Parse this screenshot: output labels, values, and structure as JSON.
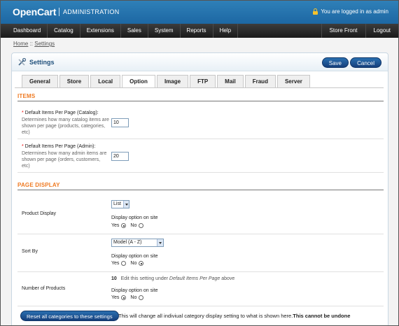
{
  "header": {
    "logo": "OpenCart",
    "subtitle": "ADMINISTRATION",
    "login_status": "You are logged in as admin"
  },
  "menu": {
    "left": [
      "Dashboard",
      "Catalog",
      "Extensions",
      "Sales",
      "System",
      "Reports",
      "Help"
    ],
    "right": [
      "Store Front",
      "Logout"
    ]
  },
  "breadcrumb": {
    "home": "Home",
    "separator": " :: ",
    "current": "Settings"
  },
  "page": {
    "title": "Settings",
    "save_label": "Save",
    "cancel_label": "Cancel",
    "tabs": [
      "General",
      "Store",
      "Local",
      "Option",
      "Image",
      "FTP",
      "Mail",
      "Fraud",
      "Server"
    ],
    "active_tab": "Option"
  },
  "items_section": {
    "title": "ITEMS",
    "catalog": {
      "label": "Default Items Per Page (Catalog):",
      "help": "Determines how many catalog items are shown per page (products, categories, etc)",
      "value": "10"
    },
    "admin": {
      "label": "Default Items Per Page (Admin):",
      "help": "Determines how many admin items are shown per page (orders, customers, etc)",
      "value": "20"
    }
  },
  "page_display": {
    "title": "PAGE DISPLAY",
    "product_display": {
      "label": "Product Display",
      "selected": "List",
      "option_label": "Display option on site",
      "yes": "Yes",
      "no": "No",
      "yes_checked": true
    },
    "sort_by": {
      "label": "Sort By",
      "selected": "Model (A - Z)",
      "option_label": "Display option on site",
      "yes": "Yes",
      "no": "No",
      "yes_checked": false
    },
    "number_of_products": {
      "label": "Number of Products",
      "value": "10",
      "note_prefix": "Edit this setting under ",
      "note_emphasis": "Default Items Per Page",
      "note_suffix": " above",
      "option_label": "Display option on site",
      "yes": "Yes",
      "no": "No",
      "yes_checked": true
    }
  },
  "reset": {
    "button_label": "Reset all categories to these settings",
    "note": "This will change all indiviual category display setting to what is shown here.",
    "warning": "This cannot be undone"
  },
  "colors": {
    "header_blue": "#1d67a3",
    "menu_dark": "#1b1b1b",
    "section_orange": "#ef7a22",
    "button_blue": "#153f7c",
    "required_red": "#ee0000"
  }
}
